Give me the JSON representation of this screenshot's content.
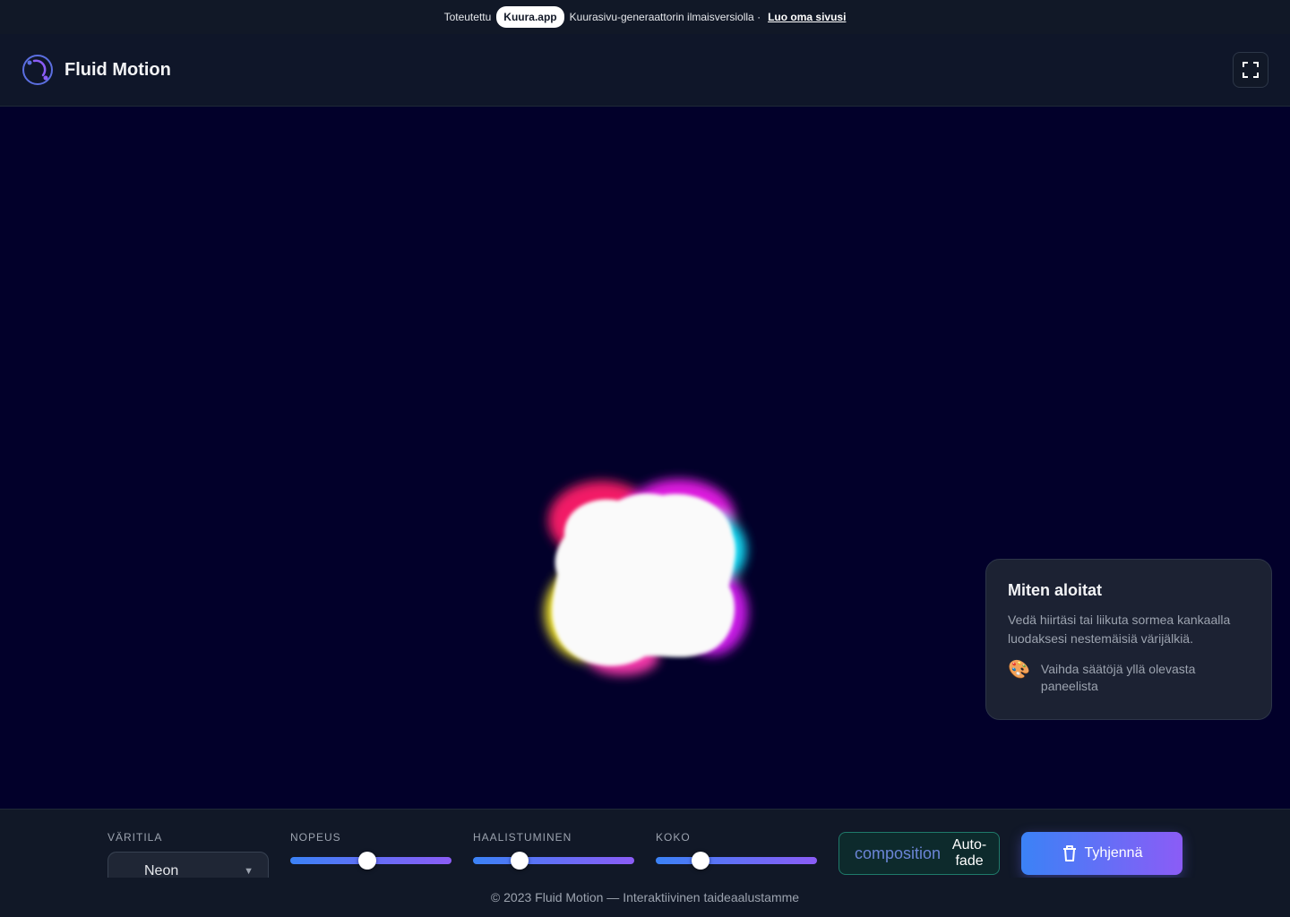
{
  "promo": {
    "prefix": "Toteutettu",
    "badge": "Kuura.app",
    "text": "Kuurasivu-generaattorin ilmaisversiolla ·",
    "cta": "Luo oma sivusi"
  },
  "header": {
    "brand": "Fluid Motion",
    "logo_icon": "swirl-logo-icon",
    "fullscreen_icon": "fullscreen-icon"
  },
  "help": {
    "title": "Miten aloitat",
    "body": "Vedä hiirtäsi tai liikuta sormea kankaalla luodaksesi nestemäisiä värijälkiä.",
    "tip_icon": "palette-icon",
    "tip": "Vaihda säätöjä yllä olevasta paneelista"
  },
  "controls": {
    "color_mode": {
      "label": "VÄRITILA",
      "value": "Neon"
    },
    "speed": {
      "label": "NOPEUS",
      "fraction": 0.48
    },
    "fade": {
      "label": "HAALISTUMINEN",
      "fraction": 0.29
    },
    "size": {
      "label": "KOKO",
      "fraction": 0.28
    },
    "composition": {
      "placeholder": "composition",
      "value": "Auto-fade"
    },
    "clear": {
      "label": "Tyhjennä",
      "icon": "trash-icon"
    }
  },
  "footer": {
    "text": "© 2023 Fluid Motion — Interaktiivinen taideaalustamme"
  },
  "colors": {
    "accent_start": "#3b82f6",
    "accent_end": "#8b5cf6",
    "canvas_bg": "#02002a"
  }
}
